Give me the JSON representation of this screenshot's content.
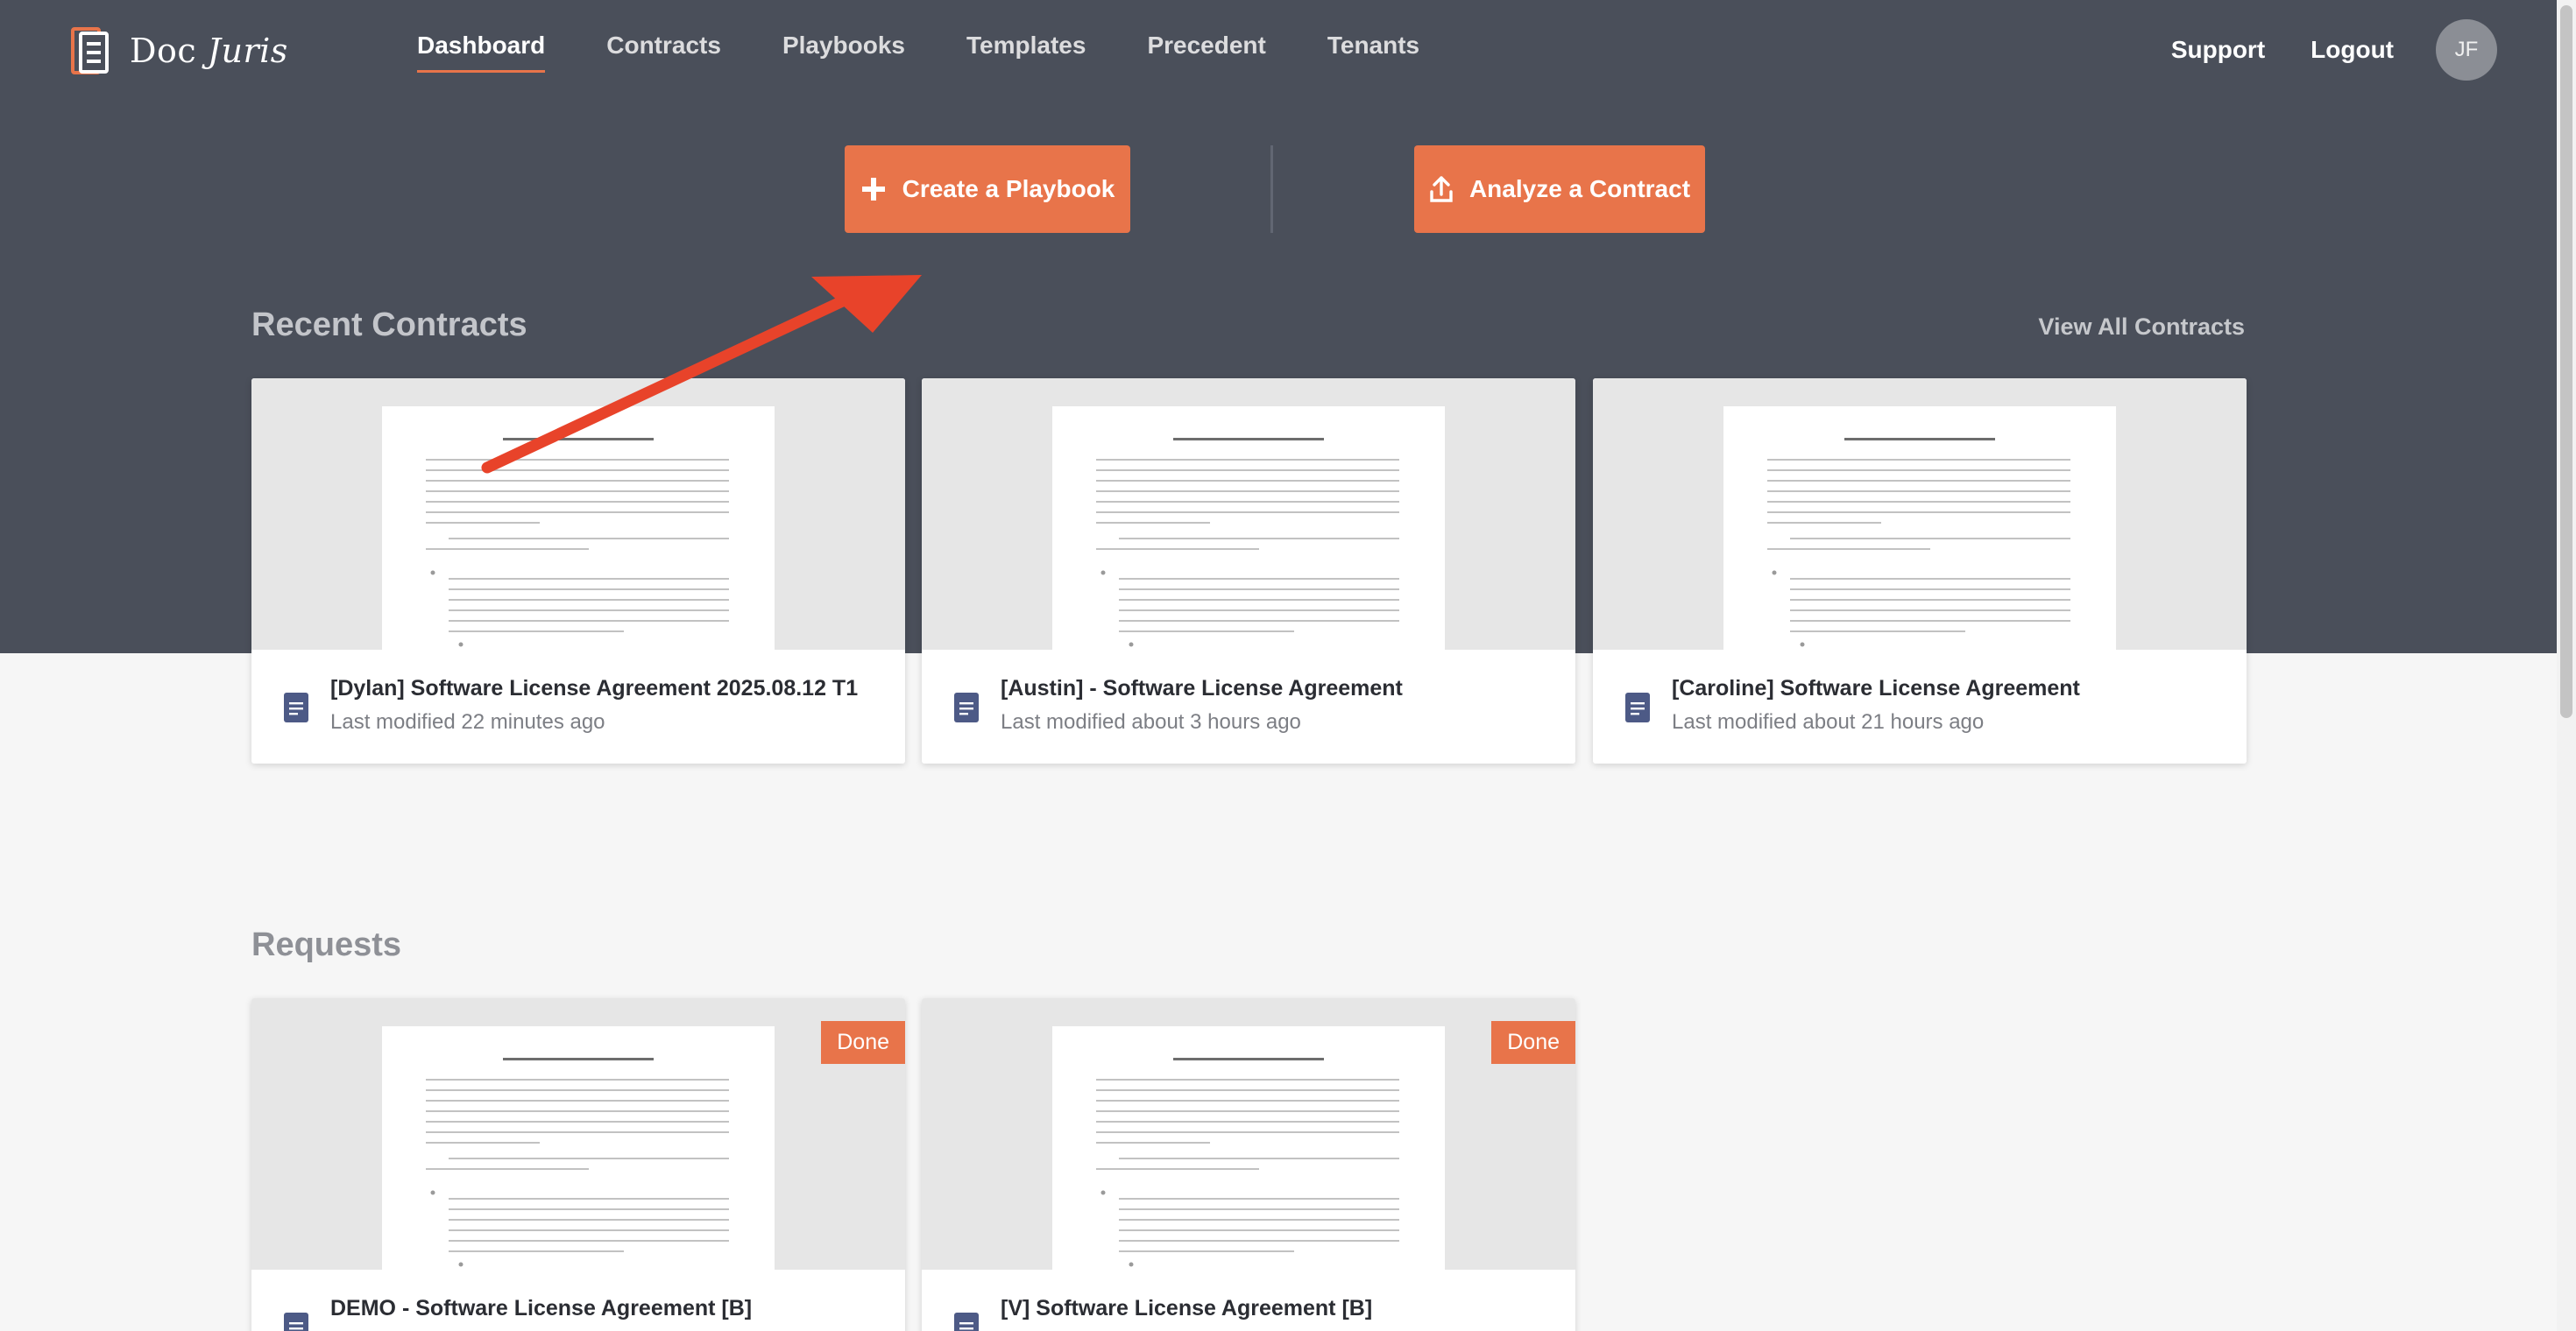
{
  "brand": {
    "doc": "Doc",
    "juris": "Juris",
    "accent": "#e8744a",
    "nav_bg": "#4a4f5a"
  },
  "nav": {
    "items": [
      {
        "label": "Dashboard",
        "active": true
      },
      {
        "label": "Contracts"
      },
      {
        "label": "Playbooks"
      },
      {
        "label": "Templates"
      },
      {
        "label": "Precedent"
      },
      {
        "label": "Tenants"
      }
    ],
    "support": "Support",
    "logout": "Logout",
    "avatar": "JF"
  },
  "actions": {
    "create": {
      "label": "Create a Playbook",
      "icon": "plus-icon"
    },
    "analyze": {
      "label": "Analyze a Contract",
      "icon": "upload-icon"
    }
  },
  "recent": {
    "title": "Recent Contracts",
    "view_all": "View All Contracts",
    "cards": [
      {
        "title": "[Dylan] Software License Agreement 2025.08.12 T1",
        "sub": "Last modified 22 minutes ago"
      },
      {
        "title": "[Austin] - Software License Agreement",
        "sub": "Last modified about 3 hours ago"
      },
      {
        "title": "[Caroline] Software License Agreement",
        "sub": "Last modified about 21 hours ago"
      }
    ]
  },
  "requests": {
    "title": "Requests",
    "cards": [
      {
        "title": "DEMO - Software License Agreement [B]",
        "badge": "Done"
      },
      {
        "title": "[V] Software License Agreement [B]",
        "badge": "Done"
      }
    ]
  },
  "annotation": {
    "color": "#e8432a",
    "icon": "arrow-annotation"
  }
}
